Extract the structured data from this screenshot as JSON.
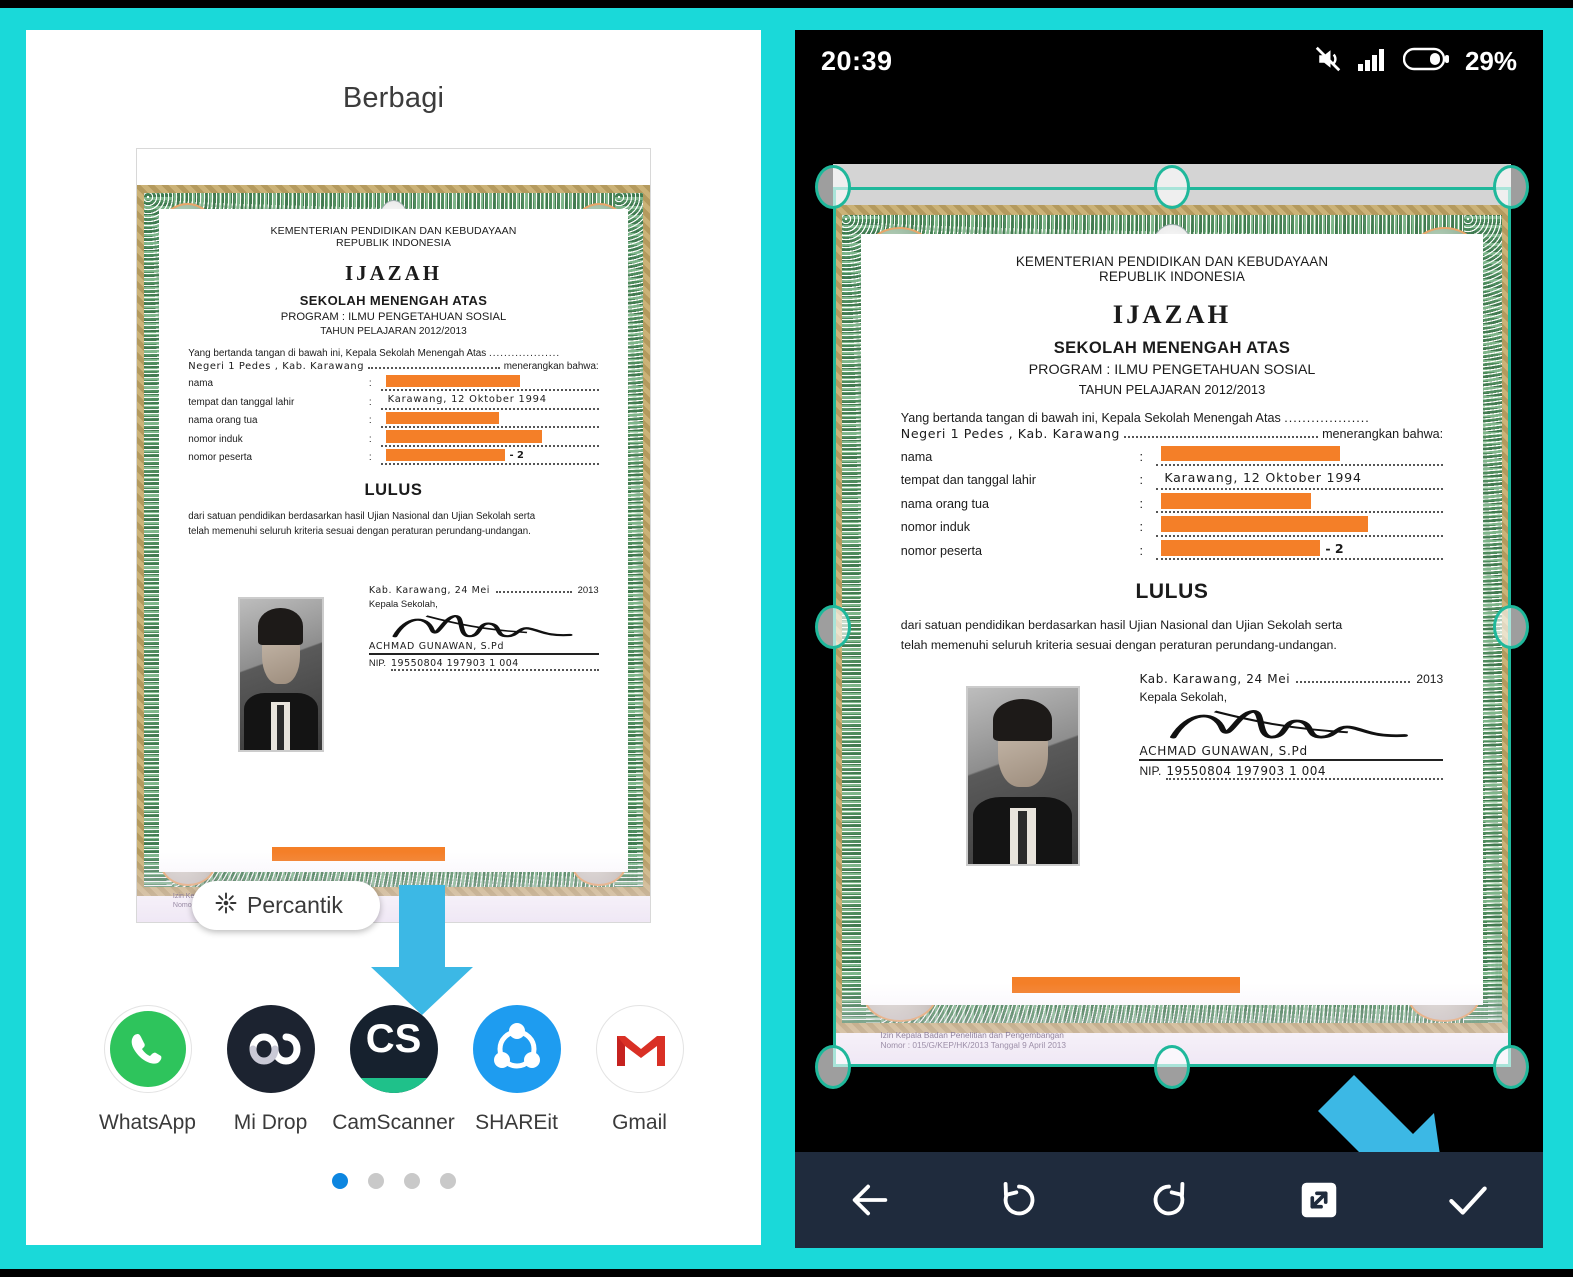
{
  "theme": {
    "background_color": "#1ad9d9",
    "accent_arrow_color": "#3cb8e5",
    "crop_guide_color": "#1fb89b",
    "redaction_color": "#f47f28"
  },
  "left_panel": {
    "title": "Berbagi",
    "enhance_button": {
      "label": "Percantik",
      "icon": "sparkle-icon"
    },
    "apps": [
      {
        "name": "WhatsApp",
        "icon": "whatsapp-icon"
      },
      {
        "name": "Mi Drop",
        "icon": "midrop-icon"
      },
      {
        "name": "CamScanner",
        "icon": "camscanner-icon",
        "glyph": "CS"
      },
      {
        "name": "SHAREit",
        "icon": "shareit-icon"
      },
      {
        "name": "Gmail",
        "icon": "gmail-icon",
        "glyph": "M"
      }
    ],
    "page_dots": {
      "count": 4,
      "active_index": 0
    }
  },
  "right_panel": {
    "status_bar": {
      "time": "20:39",
      "battery_percent": "29%",
      "icons": [
        "mute-icon",
        "signal-icon",
        "battery-icon"
      ]
    },
    "toolbar": [
      {
        "name": "back-button",
        "icon": "arrow-left-icon"
      },
      {
        "name": "rotate-left-button",
        "icon": "rotate-ccw-icon"
      },
      {
        "name": "rotate-right-button",
        "icon": "rotate-cw-icon"
      },
      {
        "name": "expand-button",
        "icon": "expand-diagonal-icon"
      },
      {
        "name": "confirm-button",
        "icon": "check-icon"
      }
    ]
  },
  "certificate": {
    "ministry_line1": "KEMENTERIAN PENDIDIKAN DAN KEBUDAYAAN",
    "ministry_line2": "REPUBLIK INDONESIA",
    "title": "IJAZAH",
    "level": "SEKOLAH MENENGAH ATAS",
    "program": "PROGRAM : ILMU PENGETAHUAN SOSIAL",
    "school_year": "TAHUN PELAJARAN 2012/2013",
    "intro": "Yang bertanda tangan di bawah ini, Kepala Sekolah Menengah Atas",
    "school_name": "Negeri 1 Pedes , Kab. Karawang",
    "intro_tail": "menerangkan bahwa:",
    "fields": [
      {
        "label": "nama",
        "value": "",
        "redacted": true
      },
      {
        "label": "tempat dan tanggal lahir",
        "value": "Karawang, 12 Oktober 1994",
        "redacted": false
      },
      {
        "label": "nama orang tua",
        "value": "",
        "redacted": true
      },
      {
        "label": "nomor induk",
        "value": "",
        "redacted": true
      },
      {
        "label": "nomor peserta",
        "value": "",
        "redacted": true,
        "suffix": "- 2"
      }
    ],
    "result": "LULUS",
    "statement_line1": "dari satuan pendidikan berdasarkan hasil Ujian Nasional dan Ujian Sekolah serta",
    "statement_line2": "telah memenuhi seluruh kriteria sesuai dengan peraturan perundang-undangan.",
    "sign_place_date": "Kab. Karawang, 24 Mei",
    "sign_year": "2013",
    "sign_role": "Kepala Sekolah,",
    "sign_name": "ACHMAD GUNAWAN, S.Pd",
    "nip_label": "NIP.",
    "nip_value": "19550804 197903 1 004",
    "footnote_line1": "Izin Kepala Badan Penelitian dan Pengembangan",
    "footnote_line2": "Nomor : 015/G/KEP/HK/2013 Tanggal  9 April 2013"
  }
}
